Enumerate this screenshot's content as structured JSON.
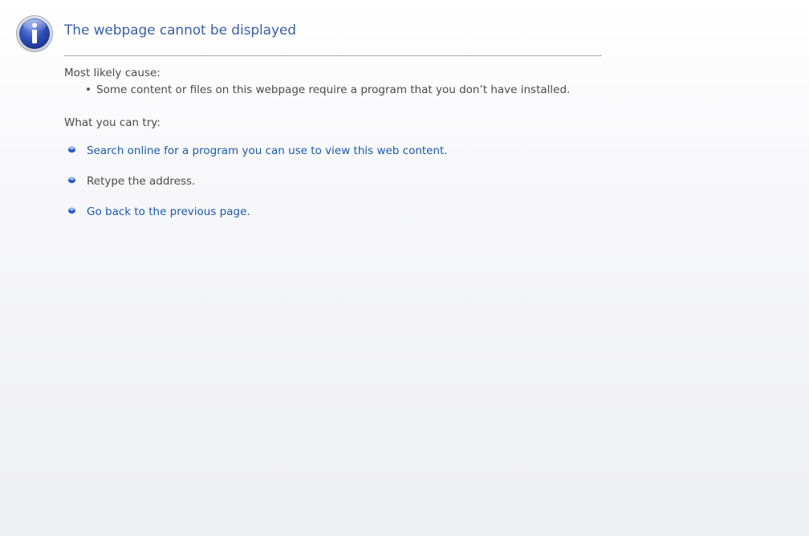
{
  "page": {
    "title": "The webpage cannot be displayed",
    "icon": "info-icon"
  },
  "cause": {
    "heading": "Most likely cause:",
    "items": [
      "Some content or files on this webpage require a program that you don’t have installed."
    ]
  },
  "try": {
    "heading": "What you can try:",
    "items": [
      {
        "label": "Search online for a program you can use to view this web content.",
        "is_link": true
      },
      {
        "label": "Retype the address.",
        "is_link": false
      },
      {
        "label": "Go back to the previous page.",
        "is_link": true
      }
    ]
  },
  "colors": {
    "title": "#3a5fa8",
    "link": "#1a5aa8",
    "text": "#4a4a4a",
    "divider": "#aaaaaa"
  }
}
